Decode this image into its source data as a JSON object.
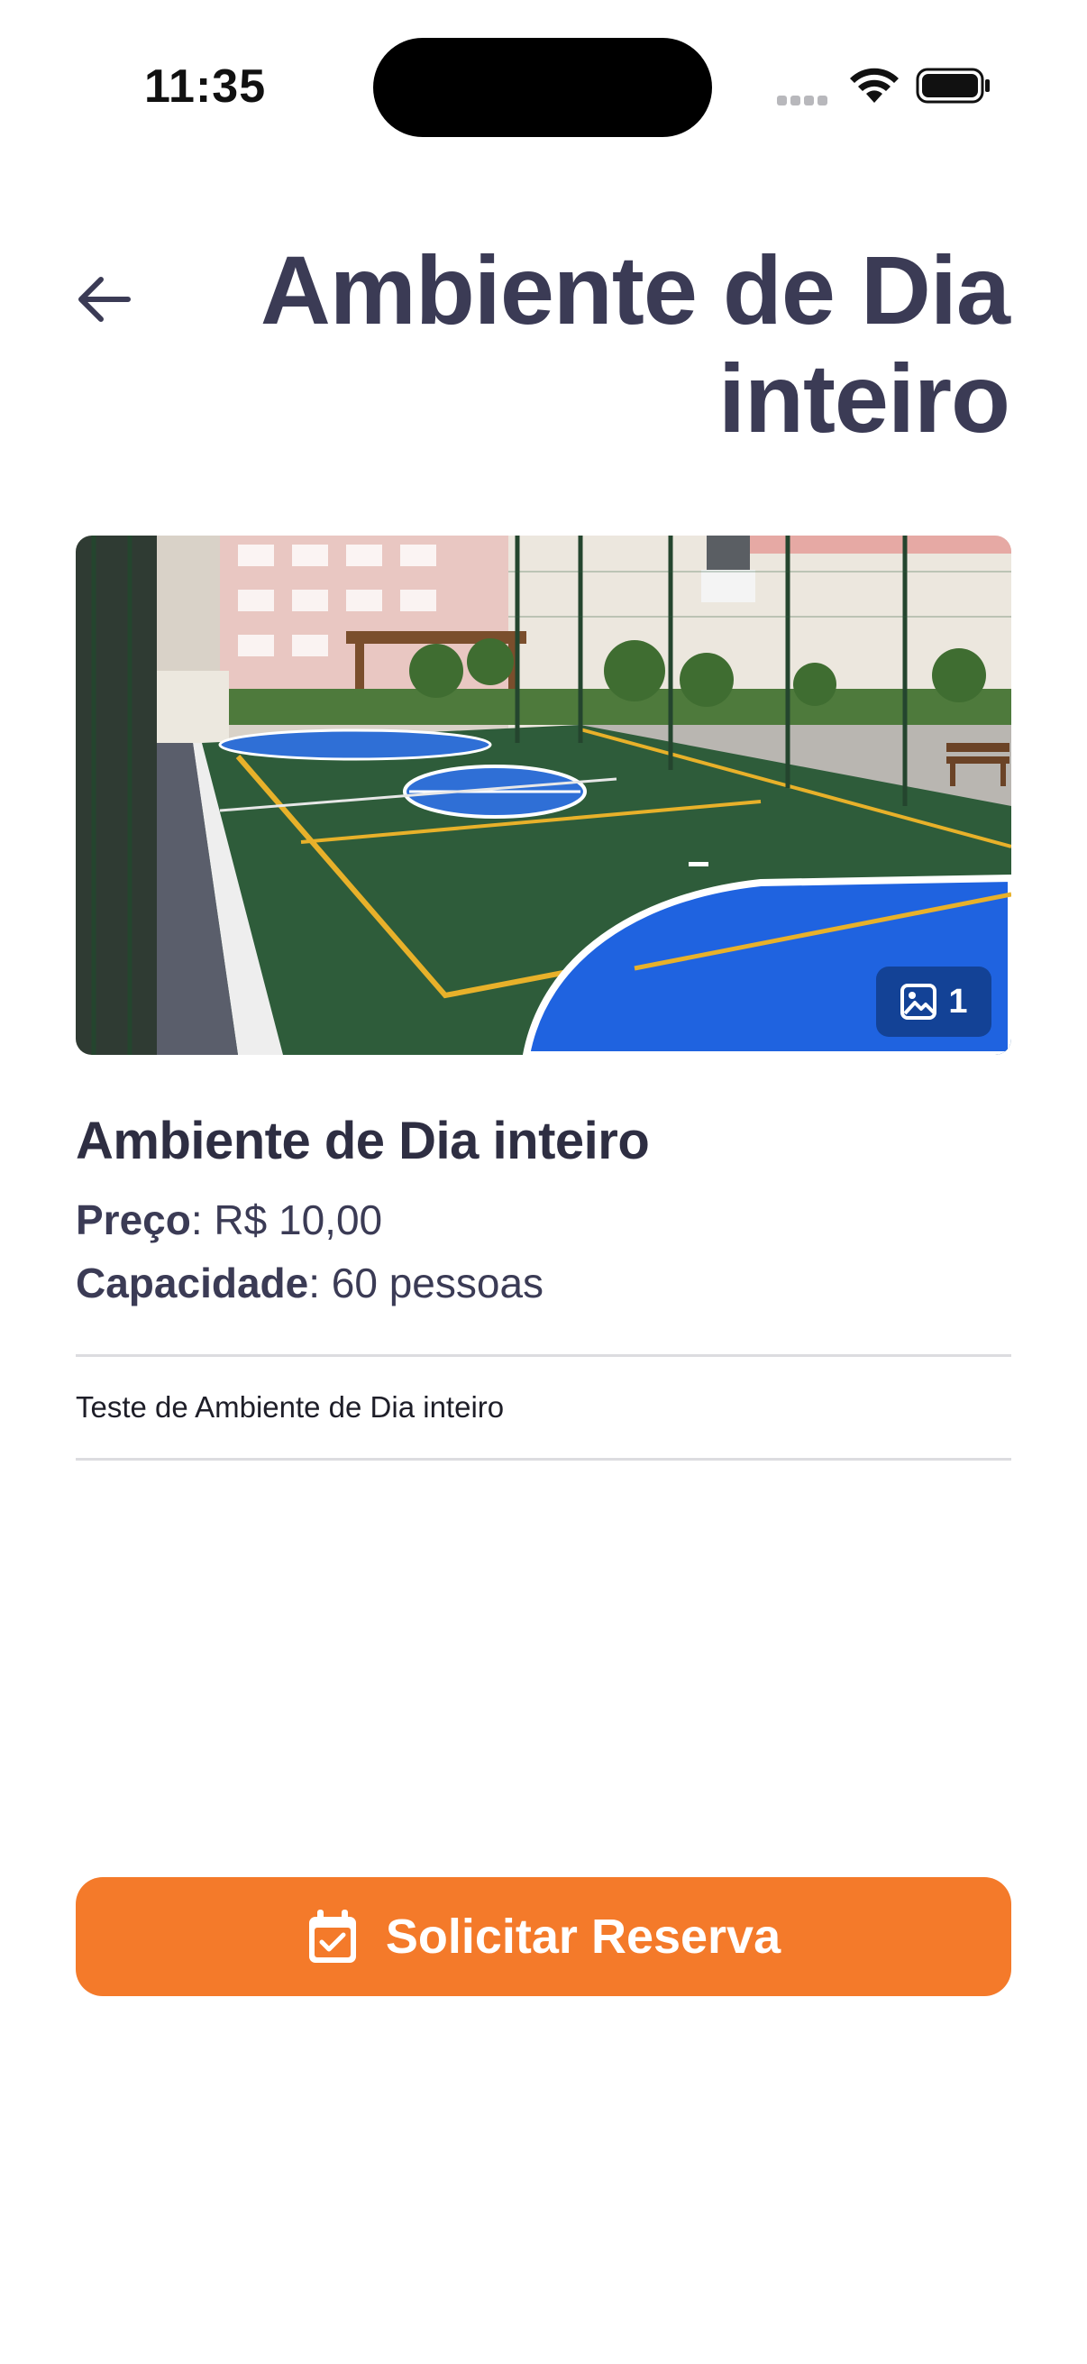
{
  "status_bar": {
    "time": "11:35"
  },
  "header": {
    "back_icon": "arrow-left-icon",
    "title": "Ambiente de Dia inteiro"
  },
  "hero": {
    "photo_count": "1",
    "gallery_icon": "image-icon"
  },
  "details": {
    "name": "Ambiente de Dia inteiro",
    "price_label": "Preço",
    "price_value": ": R$ 10,00",
    "capacity_label": "Capacidade",
    "capacity_value": ": 60 pessoas",
    "description": "Teste de Ambiente de Dia inteiro"
  },
  "actions": {
    "reserve_label": "Solicitar Reserva",
    "reserve_icon": "calendar-check-icon"
  },
  "colors": {
    "accent": "#f47a2a",
    "title": "#3b3b55"
  }
}
